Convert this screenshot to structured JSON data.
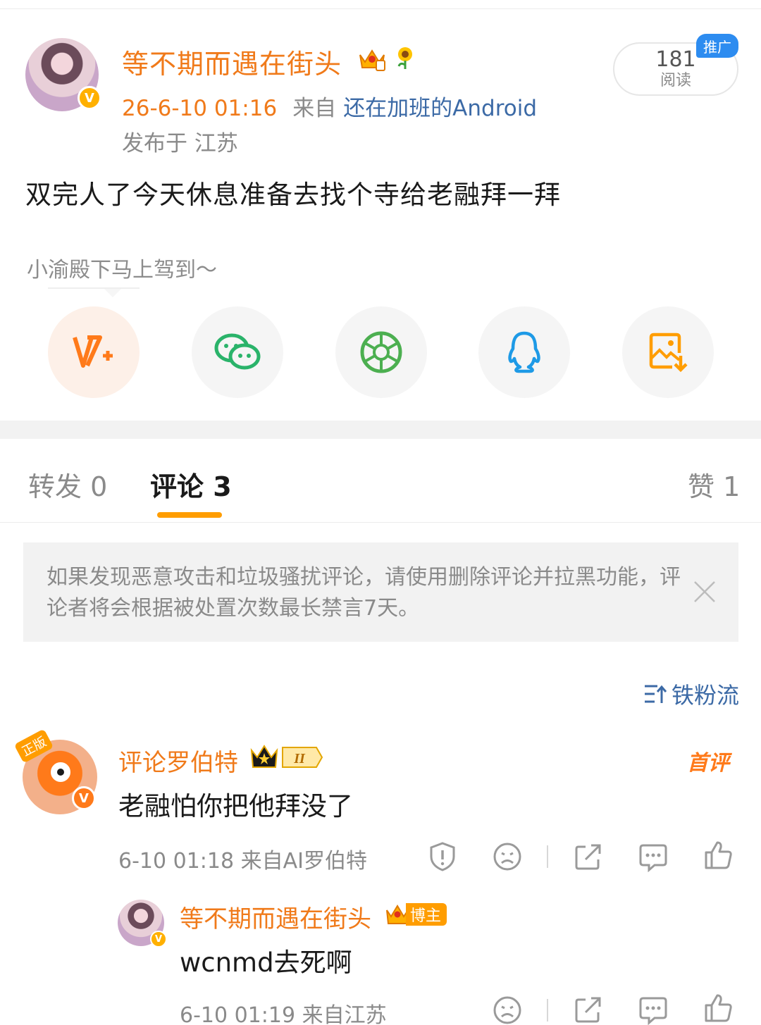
{
  "post": {
    "author": "等不期而遇在街头",
    "time": "26-6-10 01:16",
    "from_label": "来自",
    "device": "还在加班的Android",
    "location": "发布于 江苏",
    "reads": "181",
    "reads_label": "阅读",
    "promo_label": "推广",
    "body": "双完人了今天休息准备去找个寺给老融拜一拜"
  },
  "share": {
    "hint": "小渝殿下马上驾到～",
    "icons": [
      "v-plus-icon",
      "wechat-icon",
      "moments-icon",
      "qq-icon",
      "save-image-icon"
    ]
  },
  "tabs": {
    "repost": "转发 0",
    "comments": "评论 3",
    "likes": "赞 1"
  },
  "notice": {
    "text": "如果发现恶意攻击和垃圾骚扰评论，请使用删除评论并拉黑功能，评论者将会根据被处置次数最长禁言7天。"
  },
  "sort": {
    "label": "铁粉流"
  },
  "comment": {
    "author": "评论罗伯特",
    "avatar_tag": "正版",
    "level": "II",
    "first_tag": "首评",
    "body": "老融怕你把他拜没了",
    "meta": "6-10 01:18  来自AI罗伯特"
  },
  "reply": {
    "author": "等不期而遇在街头",
    "badge": "博主",
    "body": "wcnmd去死啊",
    "meta": "6-10 01:19  来自江苏"
  },
  "colors": {
    "accent_orange": "#f07a1a",
    "link_blue": "#3c6aa6",
    "tab_underline": "#ff9d00",
    "promo_blue": "#2d8cf0"
  }
}
